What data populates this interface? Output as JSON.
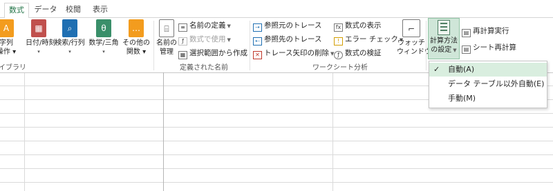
{
  "tabs": [
    {
      "label": "数式",
      "active": true
    },
    {
      "label": "データ"
    },
    {
      "label": "校閲"
    },
    {
      "label": "表示"
    }
  ],
  "library": {
    "items": [
      {
        "label": "字列",
        "label2": "操作 ▾",
        "icon": "text-icon",
        "color": "#f39c1e",
        "glyph": "A"
      },
      {
        "label": "日付/時刻",
        "label2": "▾",
        "icon": "calendar-icon",
        "color": "#c0504d",
        "glyph": "▦"
      },
      {
        "label": "検索/行列",
        "label2": "▾",
        "icon": "lookup-icon",
        "color": "#1f6fb2",
        "glyph": "⌕"
      },
      {
        "label": "数学/三角",
        "label2": "▾",
        "icon": "math-icon",
        "color": "#3a8f6a",
        "glyph": "θ"
      },
      {
        "label": "その他の",
        "label2": "関数 ▾",
        "icon": "more-functions-icon",
        "color": "#f39c1e",
        "glyph": "…"
      }
    ],
    "group_label": "イブラリ"
  },
  "names": {
    "manager_label1": "名前の",
    "manager_label2": "管理",
    "define_name": "名前の定義",
    "use_in_formula": "数式で使用",
    "create_from_selection": "選択範囲から作成",
    "group_label": "定義された名前"
  },
  "audit": {
    "trace_precedents": "参照元のトレース",
    "trace_dependents": "参照先のトレース",
    "remove_arrows": "トレース矢印の削除",
    "show_formulas": "数式の表示",
    "error_checking": "エラー チェック",
    "evaluate_formula": "数式の検証",
    "watch_label1": "ウォッチ",
    "watch_label2": "ウィンドウ",
    "group_label": "ワークシート分析"
  },
  "calc": {
    "options_label1": "計算方法",
    "options_label2": "の設定",
    "calc_now": "再計算実行",
    "calc_sheet": "シート再計算"
  },
  "calc_menu": {
    "items": [
      {
        "label": "自動(A)",
        "checked": true
      },
      {
        "label": "データ テーブル以外自動(E)",
        "checked": false
      },
      {
        "label": "手動(M)",
        "checked": false
      }
    ],
    "check_glyph": "✓"
  },
  "colors": {
    "accent": "#217346",
    "menu_hover": "#d9eedf",
    "calc_button_active": "#cfe6d8"
  }
}
